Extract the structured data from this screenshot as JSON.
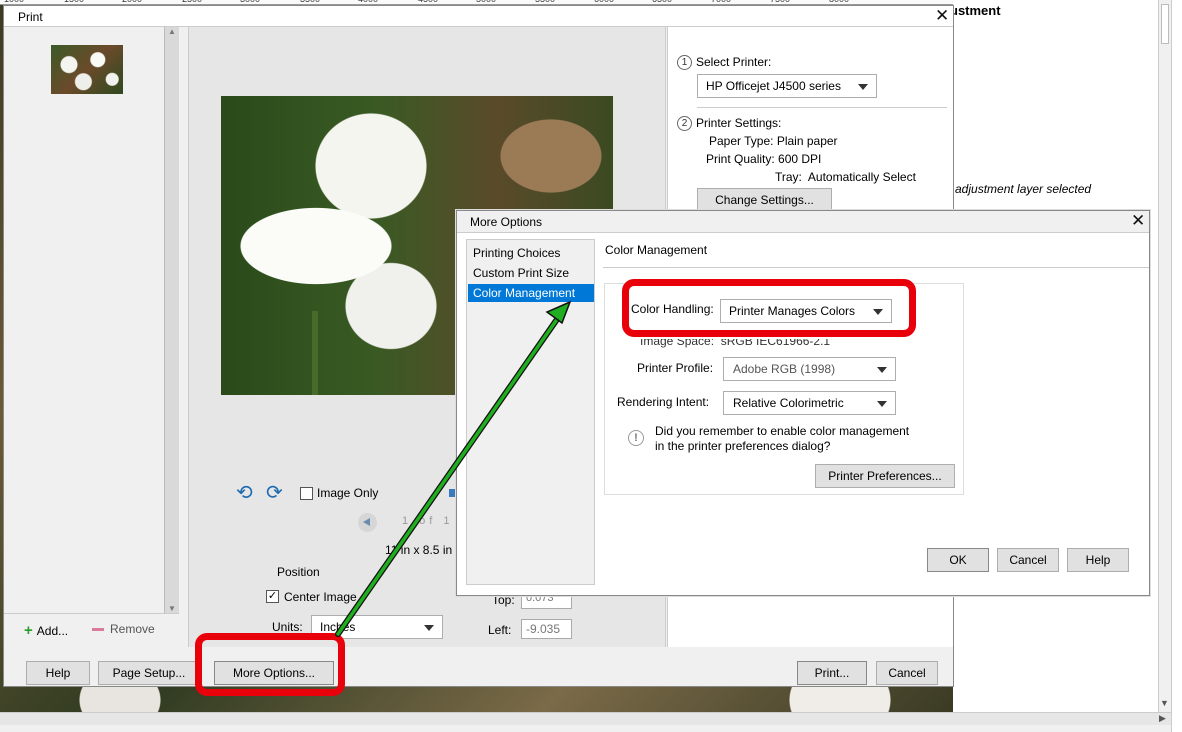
{
  "background": {
    "ruler_ticks": [
      "1000",
      "1500",
      "2000",
      "2500",
      "3000",
      "3500",
      "4000",
      "4500",
      "5000",
      "5500",
      "6000",
      "6500",
      "7000",
      "7500",
      "8000"
    ],
    "panel_title": "ustment",
    "panel_status": "adjustment layer selected"
  },
  "print_dialog": {
    "title": "Print",
    "close_glyph": "✕",
    "sidebar": {
      "add_label": "Add...",
      "remove_label": "Remove"
    },
    "preview": {
      "image_only_label": "Image Only",
      "page_counter": "1 of 1",
      "paper_size": "11 in x 8.5 in"
    },
    "position": {
      "heading": "Position",
      "center_image_label": "Center Image",
      "center_image_checked": true,
      "units_label": "Units:",
      "units_value": "Inches",
      "top_label": "Top:",
      "top_value": "0.073",
      "left_label": "Left:",
      "left_value": "-9.035"
    },
    "settings": {
      "step1_num": "1",
      "step1_label": "Select Printer:",
      "printer_value": "HP Officejet J4500 series",
      "step2_num": "2",
      "step2_label": "Printer Settings:",
      "paper_type": "Paper Type: Plain paper",
      "print_quality": "Print Quality: 600 DPI",
      "tray": "Tray:  Automatically Select",
      "change_settings_label": "Change Settings..."
    },
    "footer": {
      "help_label": "Help",
      "page_setup_label": "Page Setup...",
      "more_options_label": "More Options...",
      "print_label": "Print...",
      "cancel_label": "Cancel"
    }
  },
  "more_options_dialog": {
    "title": "More Options",
    "close_glyph": "✕",
    "nav_items": [
      "Printing Choices",
      "Custom Print Size",
      "Color Management"
    ],
    "selected_nav": "Color Management",
    "section_title": "Color Management",
    "color_handling_label": "Color Handling:",
    "color_handling_value": "Printer Manages Colors",
    "image_space": "Image Space:  sRGB IEC61966-2.1",
    "printer_profile_label": "Printer Profile:",
    "printer_profile_value": "Adobe RGB (1998)",
    "rendering_intent_label": "Rendering Intent:",
    "rendering_intent_value": "Relative Colorimetric",
    "reminder_icon": "!",
    "reminder_line1": "Did you remember to enable color management",
    "reminder_line2": "in the printer preferences dialog?",
    "printer_preferences_label": "Printer Preferences...",
    "ok_label": "OK",
    "cancel_label": "Cancel",
    "help_label": "Help"
  },
  "annotations": {
    "highlight_color": "#e8000b",
    "arrow_color": "#1fae1f",
    "accent_selection_color": "#0078d7"
  }
}
